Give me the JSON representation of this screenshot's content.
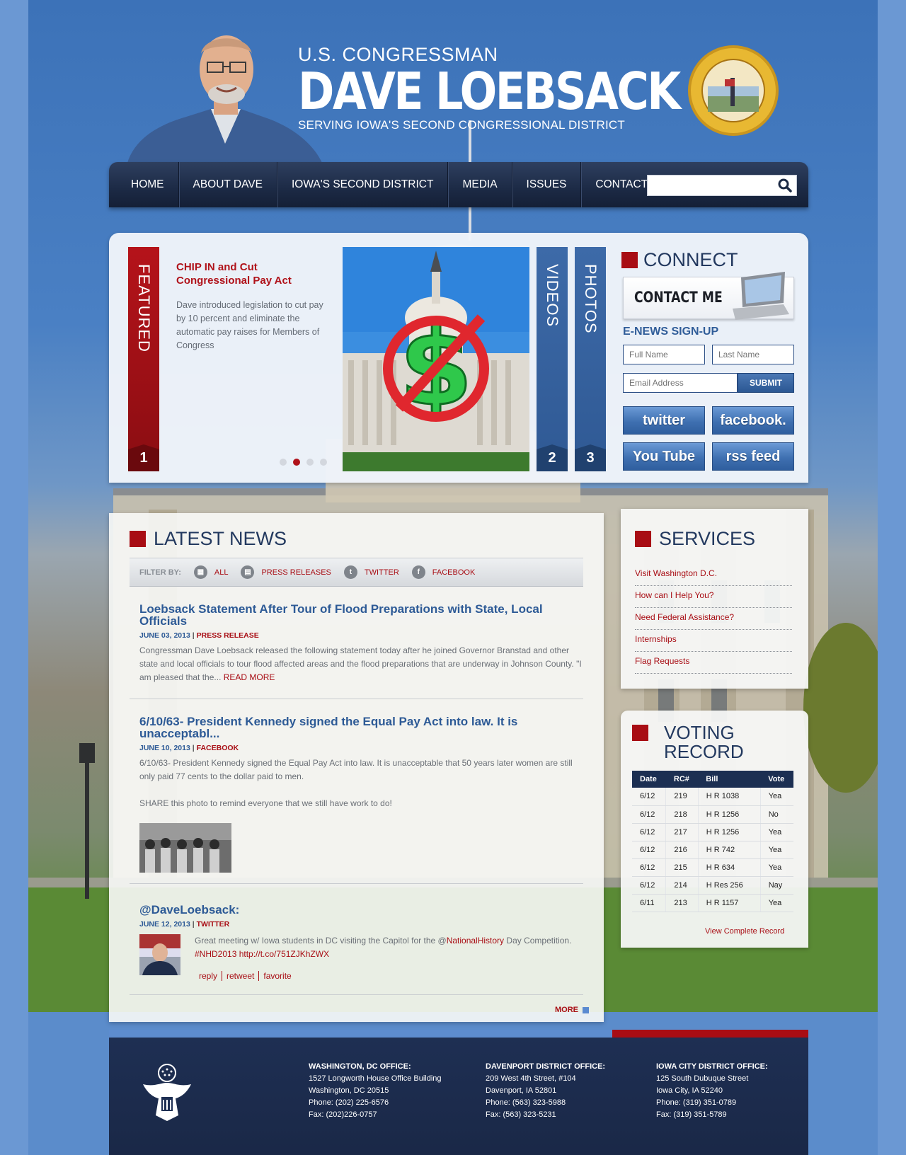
{
  "header": {
    "line1": "U.S. CONGRESSMAN",
    "name": "DAVE LOEBSACK",
    "tagline": "SERVING IOWA'S SECOND CONGRESSIONAL DISTRICT"
  },
  "nav": {
    "items": [
      "HOME",
      "ABOUT DAVE",
      "IOWA'S SECOND DISTRICT",
      "MEDIA",
      "ISSUES",
      "CONTACT"
    ],
    "search_placeholder": ""
  },
  "featured": {
    "tab_label": "FEATURED",
    "tab_number": "1",
    "title": "CHIP IN and Cut Congressional Pay Act",
    "text": "Dave introduced legislation to cut pay by 10 percent and eliminate the automatic pay raises for Members of Congress",
    "slides": 4,
    "active_slide": 2,
    "videos_label": "VIDEOS",
    "videos_number": "2",
    "photos_label": "PHOTOS",
    "photos_number": "3"
  },
  "connect": {
    "heading": "CONNECT",
    "contact_button": "CONTACT ME",
    "enews_heading": "E-NEWS SIGN-UP",
    "first_name_placeholder": "Full Name",
    "last_name_placeholder": "Last Name",
    "email_placeholder": "Email Address",
    "submit": "SUBMIT",
    "social": [
      "twitter",
      "facebook.",
      "You Tube",
      "rss feed"
    ]
  },
  "news": {
    "heading": "LATEST NEWS",
    "filter_label": "FILTER BY:",
    "filters": [
      "ALL",
      "PRESS RELEASES",
      "TWITTER",
      "FACEBOOK"
    ],
    "posts": [
      {
        "title": "Loebsack Statement After Tour of Flood Preparations with State, Local Officials",
        "date": "JUNE 03, 2013",
        "type": "PRESS RELEASE",
        "body": "Congressman Dave Loebsack released the following statement today after he joined Governor Branstad and other state and local officials to tour flood affected areas and the flood preparations that are underway in Johnson County. \"I am pleased that the...",
        "read_more": "READ MORE"
      },
      {
        "title": "6/10/63- President Kennedy signed the Equal Pay Act into law. It is unacceptabl...",
        "date": "JUNE 10, 2013",
        "type": "FACEBOOK",
        "body": "6/10/63- President Kennedy signed the Equal Pay Act into law. It is unacceptable that 50 years later women are still only paid 77 cents to the dollar paid to men.",
        "body2": "SHARE this photo to remind everyone that we still have work to do!"
      },
      {
        "title": "@DaveLoebsack:",
        "date": "JUNE 12, 2013",
        "type": "TWITTER",
        "tweet_before": "Great meeting w/ Iowa students in DC visiting the Capitol for the @",
        "tweet_mention": "NationalHistory",
        "tweet_after": " Day Competition.",
        "tweet_links": "#NHD2013 http://t.co/751ZJKhZWX",
        "actions": [
          "reply",
          "retweet",
          "favorite"
        ]
      }
    ],
    "more": "MORE"
  },
  "services": {
    "heading": "SERVICES",
    "items": [
      "Visit Washington D.C.",
      "How can I Help You?",
      "Need Federal Assistance?",
      "Internships",
      "Flag Requests"
    ]
  },
  "voting": {
    "heading_line1": "VOTING",
    "heading_line2": "RECORD",
    "columns": [
      "Date",
      "RC#",
      "Bill",
      "Vote"
    ],
    "rows": [
      [
        "6/12",
        "219",
        "H R 1038",
        "Yea"
      ],
      [
        "6/12",
        "218",
        "H R 1256",
        "No"
      ],
      [
        "6/12",
        "217",
        "H R 1256",
        "Yea"
      ],
      [
        "6/12",
        "216",
        "H R 742",
        "Yea"
      ],
      [
        "6/12",
        "215",
        "H R 634",
        "Yea"
      ],
      [
        "6/12",
        "214",
        "H Res 256",
        "Nay"
      ],
      [
        "6/11",
        "213",
        "H R 1157",
        "Yea"
      ]
    ],
    "link": "View Complete Record"
  },
  "footer": {
    "offices": [
      {
        "name": "WASHINGTON, DC OFFICE:",
        "line1": "1527 Longworth House Office Building",
        "line2": "Washington, DC 20515",
        "phone": "Phone: (202) 225-6576",
        "fax": "Fax: (202)226-0757"
      },
      {
        "name": "DAVENPORT DISTRICT OFFICE:",
        "line1": "209 West 4th Street, #104",
        "line2": "Davenport, IA 52801",
        "phone": "Phone: (563) 323-5988",
        "fax": "Fax: (563) 323-5231"
      },
      {
        "name": "IOWA CITY DISTRICT OFFICE:",
        "line1": "125 South Dubuque Street",
        "line2": "Iowa City, IA 52240",
        "phone": "Phone: (319) 351-0789",
        "fax": "Fax: (319) 351-5789"
      }
    ]
  },
  "colors": {
    "brand_red": "#a80d14",
    "navy": "#1c2f52",
    "link_blue": "#2d5a96",
    "sky_blue": "#5b8ccb"
  },
  "icons": [
    "search-icon",
    "seal-icon",
    "laptop-icon",
    "grid-icon",
    "document-icon",
    "twitter-icon",
    "facebook-icon",
    "eagle-icon"
  ]
}
